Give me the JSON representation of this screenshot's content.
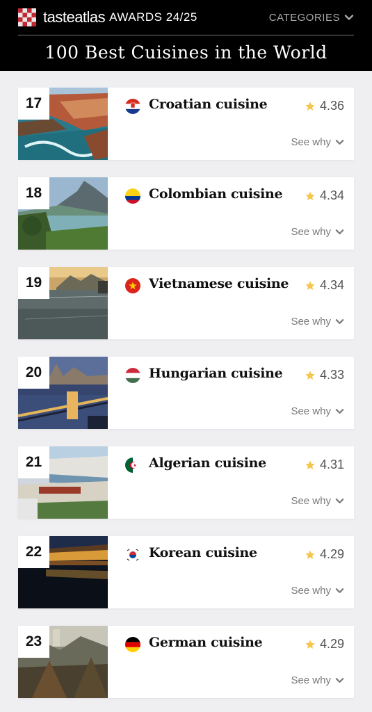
{
  "header": {
    "logo_text": "tasteatlas",
    "awards_label": "AWARDS 24/25",
    "categories_label": "CATEGORIES",
    "page_title": "100 Best Cuisines in the World"
  },
  "colors": {
    "star": "#f3c64f",
    "background": "#efeff2",
    "header_bg": "#000000"
  },
  "items": [
    {
      "rank": "17",
      "name": "Croatian cuisine",
      "rating": "4.36",
      "see_why": "See why",
      "flag_icon": "croatia-flag-icon"
    },
    {
      "rank": "18",
      "name": "Colombian cuisine",
      "rating": "4.34",
      "see_why": "See why",
      "flag_icon": "colombia-flag-icon"
    },
    {
      "rank": "19",
      "name": "Vietnamese cuisine",
      "rating": "4.34",
      "see_why": "See why",
      "flag_icon": "vietnam-flag-icon"
    },
    {
      "rank": "20",
      "name": "Hungarian cuisine",
      "rating": "4.33",
      "see_why": "See why",
      "flag_icon": "hungary-flag-icon"
    },
    {
      "rank": "21",
      "name": "Algerian cuisine",
      "rating": "4.31",
      "see_why": "See why",
      "flag_icon": "algeria-flag-icon"
    },
    {
      "rank": "22",
      "name": "Korean cuisine",
      "rating": "4.29",
      "see_why": "See why",
      "flag_icon": "korea-flag-icon"
    },
    {
      "rank": "23",
      "name": "German cuisine",
      "rating": "4.29",
      "see_why": "See why",
      "flag_icon": "germany-flag-icon"
    }
  ]
}
